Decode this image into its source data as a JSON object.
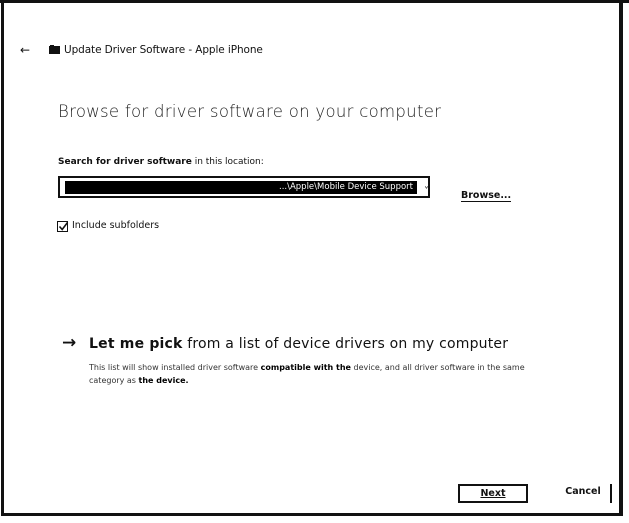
{
  "header": {
    "back_glyph": "←",
    "title": "Update Driver Software - Apple iPhone"
  },
  "main": {
    "heading": "Browse for driver software on your computer",
    "search_label_bold": "Search for driver software",
    "search_label_rest": " in this location:",
    "path_value": "...\\Apple\\Mobile Device Support",
    "browse_label": "Browse...",
    "include_subfolders_label": "Include subfolders",
    "include_subfolders_checked": true
  },
  "pick": {
    "arrow": "→",
    "title_bold": "Let me pick",
    "title_rest": " from a list of device drivers on my computer",
    "desc_1": "This list will show installed driver software ",
    "desc_bold_1": "compatible with the",
    "desc_2": " device, and all driver software in the same category as ",
    "desc_bold_2": "the device."
  },
  "footer": {
    "next_label": "Next",
    "cancel_label": "Cancel"
  }
}
